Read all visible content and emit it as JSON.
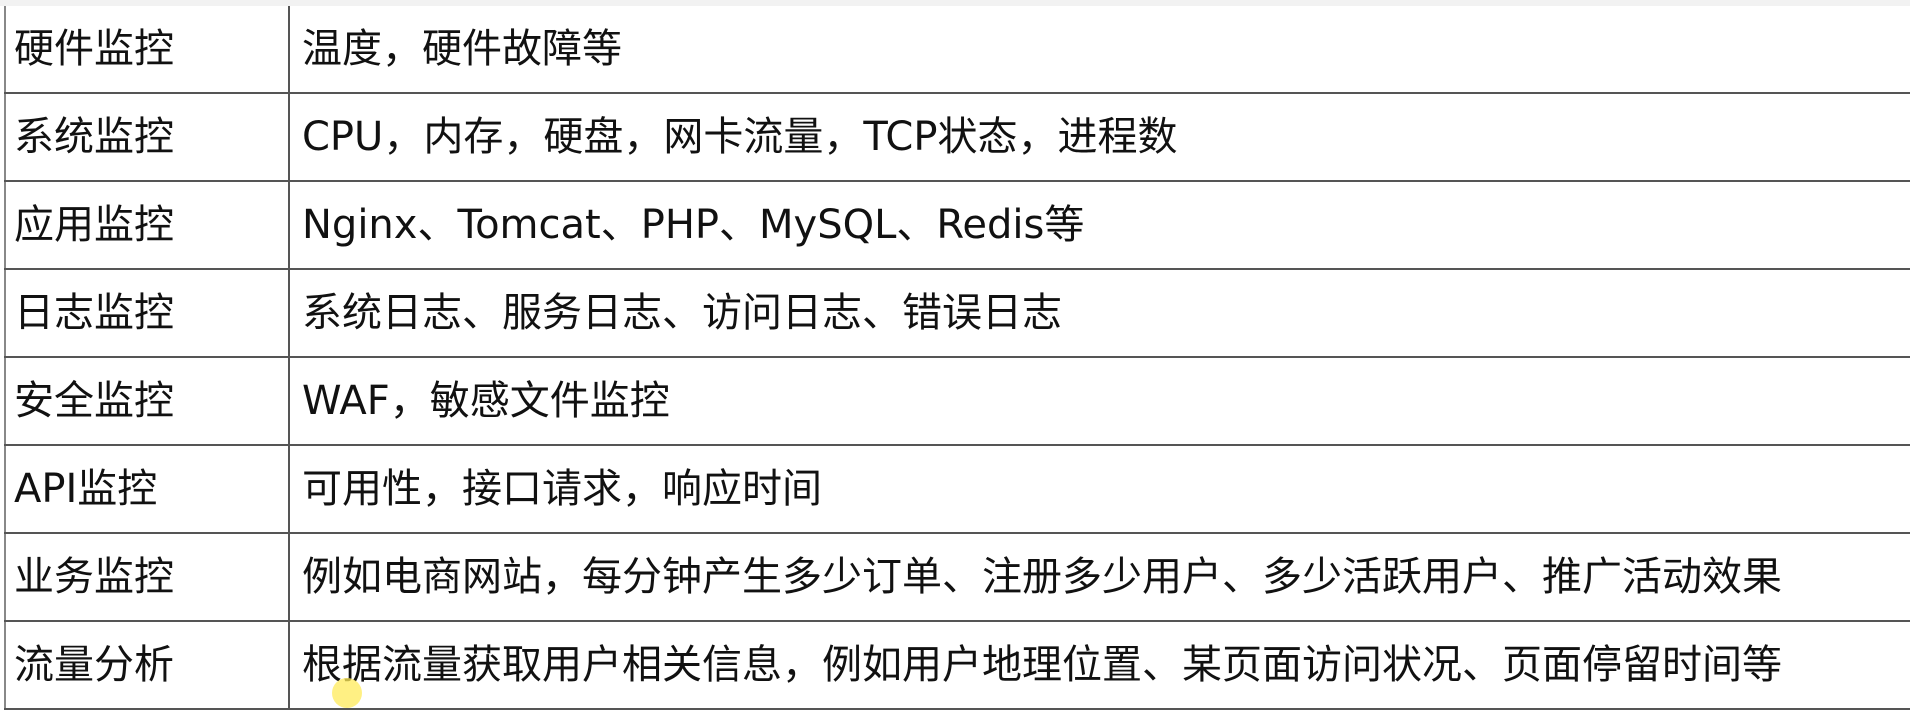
{
  "table": {
    "rows": [
      {
        "category": "硬件监控",
        "description": "温度，硬件故障等"
      },
      {
        "category": "系统监控",
        "description": "CPU，内存，硬盘，网卡流量，TCP状态，进程数"
      },
      {
        "category": "应用监控",
        "description": "Nginx、Tomcat、PHP、MySQL、Redis等"
      },
      {
        "category": "日志监控",
        "description": "系统日志、服务日志、访问日志、错误日志"
      },
      {
        "category": "安全监控",
        "description": "WAF，敏感文件监控"
      },
      {
        "category": "API监控",
        "description": "可用性，接口请求，响应时间"
      },
      {
        "category": "业务监控",
        "description": "例如电商网站，每分钟产生多少订单、注册多少用户、多少活跃用户、推广活动效果"
      },
      {
        "category": "流量分析",
        "description": "根据流量获取用户相关信息，例如用户地理位置、某页面访问状况、页面停留时间等"
      }
    ]
  },
  "colors": {
    "grid_line": "#555555",
    "cursor_highlight": "#ffeb5a"
  }
}
